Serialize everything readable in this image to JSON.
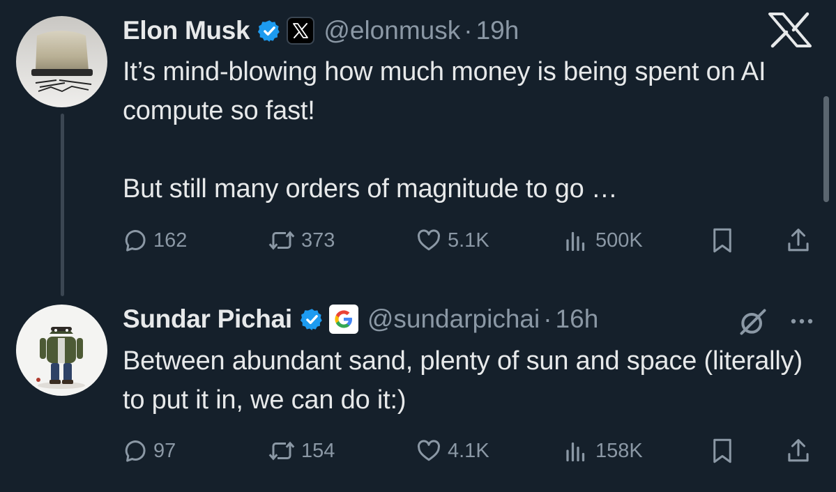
{
  "brand": {
    "logo_icon": "x-logo-icon",
    "accent_color": "#1d9bf0"
  },
  "tweets": [
    {
      "author": {
        "name": "Elon Musk",
        "handle": "@elonmusk",
        "verified_icon": "verified-badge-icon",
        "affiliate_icon": "x-affiliate-icon"
      },
      "separator": "·",
      "time": "19h",
      "text": {
        "paragraph1": "It’s mind-blowing how much money is being spent on AI compute so fast!",
        "paragraph2": "But still many orders of magnitude to go …"
      },
      "stats": {
        "replies": "162",
        "reposts": "373",
        "likes": "5.1K",
        "views": "500K"
      }
    },
    {
      "author": {
        "name": "Sundar Pichai",
        "handle": "@sundarpichai",
        "verified_icon": "verified-badge-icon",
        "affiliate_icon": "google-affiliate-icon"
      },
      "separator": "·",
      "time": "16h",
      "text": {
        "paragraph1": "Between abundant sand, plenty of sun and space (literally) to put it in, we can do it:)"
      },
      "stats": {
        "replies": "97",
        "reposts": "154",
        "likes": "4.1K",
        "views": "158K"
      }
    }
  ]
}
